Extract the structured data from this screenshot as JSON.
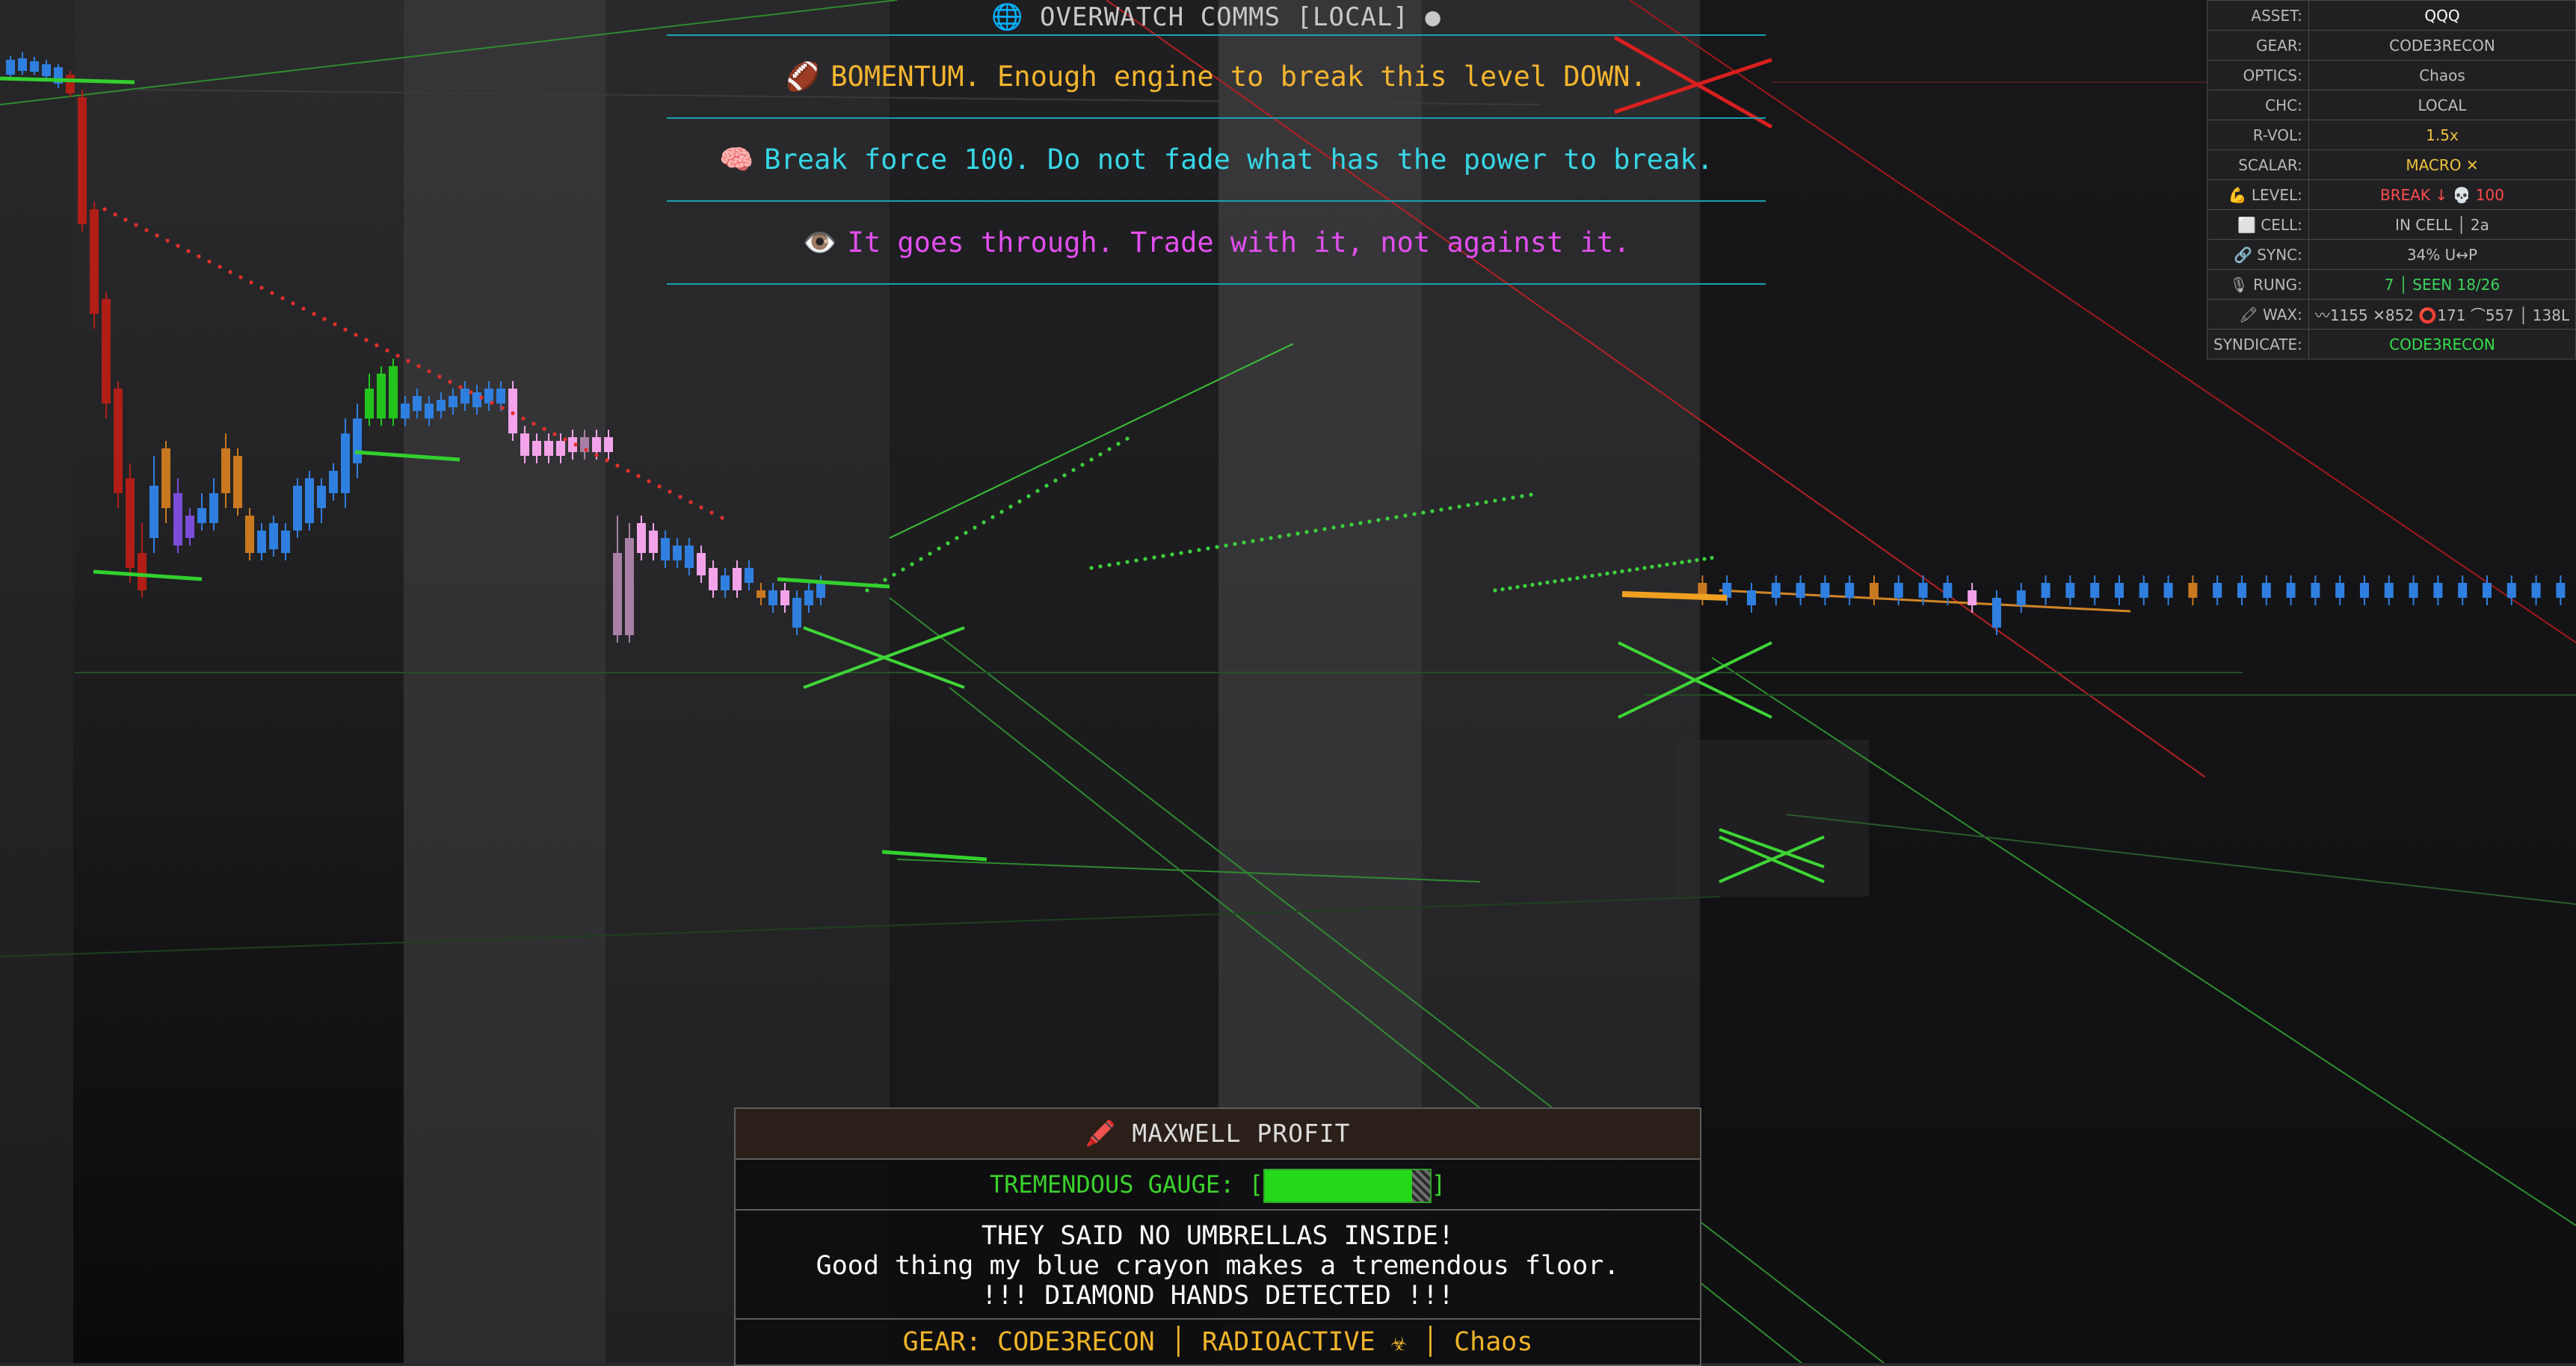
{
  "comms": {
    "title": "OVERWATCH COMMS [LOCAL]",
    "status_dot": "●",
    "globe_icon": "globe-icon",
    "messages": [
      {
        "icon": "🏈",
        "icon_name": "football-icon",
        "text": "BOMENTUM. Enough engine to break this level DOWN.",
        "color": "#f5b52e"
      },
      {
        "icon": "🧠",
        "icon_name": "brain-icon",
        "text": "Break force 100. Do not fade what has the power to break.",
        "color": "#37d6e6"
      },
      {
        "icon": "👁️",
        "icon_name": "eye-icon",
        "text": "It goes through. Trade with it, not against it.",
        "color": "#e34ff0"
      }
    ]
  },
  "stats": [
    {
      "key": "ASSET:",
      "value": "QQQ",
      "color": "#ffffff"
    },
    {
      "key": "GEAR:",
      "value": "CODE3RECON",
      "color": "#bdbdbd"
    },
    {
      "key": "OPTICS:",
      "value": "Chaos",
      "color": "#bdbdbd"
    },
    {
      "key": "CHC:",
      "value": "LOCAL",
      "color": "#bdbdbd"
    },
    {
      "key": "R-VOL:",
      "value": "1.5x",
      "color": "#f0c23a"
    },
    {
      "key": "SCALAR:",
      "value": "MACRO ✕",
      "color": "#f0c23a"
    },
    {
      "key": "💪 LEVEL:",
      "value": "BREAK ↓ 💀 100",
      "color": "#ff4b4b"
    },
    {
      "key": "⬜ CELL:",
      "value": "IN CELL │ 2a",
      "color": "#bdbdbd"
    },
    {
      "key": "🔗 SYNC:",
      "value": "34% U↔P",
      "color": "#bdbdbd"
    },
    {
      "key": "🎙 RUNG:",
      "value": "7 │ SEEN 18/26",
      "color": "#3cd65a"
    },
    {
      "key": "🖍 WAX:",
      "value": "〰1155 ✕852 ⭕171 ⌒557 │ 138L",
      "color": "#bdbdbd"
    },
    {
      "key": "SYNDICATE:",
      "value": "CODE3RECON",
      "color": "#33e04a"
    }
  ],
  "maxwell": {
    "icon": "🖍️",
    "icon_name": "crayon-icon",
    "title": "MAXWELL PROFIT",
    "gauge_label": "TREMENDOUS GAUGE: [",
    "gauge_close": "]",
    "gauge_level": 0.9,
    "lines": [
      "THEY SAID NO UMBRELLAS INSIDE!",
      "Good thing my blue crayon makes a tremendous floor.",
      "!!! DIAMOND HANDS DETECTED !!!"
    ],
    "footer": "GEAR: CODE3RECON │ RADIOACTIVE ☣ │ Chaos"
  },
  "chart_data": {
    "type": "candlestick",
    "colors": {
      "blue": "#2f7fe0",
      "pink": "#f3a3ea",
      "purple": "#7a4cd9",
      "orange": "#c9781f",
      "red": "#b01e16",
      "green": "#22c41d",
      "mauve": "#a87fa5",
      "teal": "#4a7a5a",
      "trail_red": "#e3302a",
      "trail_green": "#3bd23b"
    },
    "candles": [
      [
        8,
        80,
        100,
        75,
        105,
        "blue"
      ],
      [
        24,
        78,
        95,
        70,
        100,
        "blue"
      ],
      [
        40,
        82,
        96,
        76,
        100,
        "blue"
      ],
      [
        56,
        86,
        102,
        80,
        106,
        "blue"
      ],
      [
        72,
        90,
        112,
        86,
        118,
        "blue"
      ],
      [
        88,
        100,
        125,
        95,
        130,
        "red"
      ],
      [
        104,
        130,
        300,
        120,
        310,
        "red"
      ],
      [
        120,
        280,
        420,
        270,
        440,
        "red"
      ],
      [
        136,
        400,
        540,
        390,
        560,
        "red"
      ],
      [
        152,
        520,
        660,
        510,
        680,
        "red"
      ],
      [
        168,
        640,
        760,
        620,
        780,
        "red"
      ],
      [
        184,
        740,
        790,
        700,
        800,
        "red"
      ],
      [
        200,
        650,
        720,
        610,
        740,
        "blue"
      ],
      [
        216,
        600,
        680,
        590,
        700,
        "orange"
      ],
      [
        232,
        660,
        730,
        640,
        740,
        "purple"
      ],
      [
        248,
        690,
        720,
        680,
        730,
        "purple"
      ],
      [
        264,
        680,
        700,
        660,
        710,
        "blue"
      ],
      [
        280,
        660,
        700,
        640,
        710,
        "blue"
      ],
      [
        296,
        600,
        660,
        580,
        680,
        "orange"
      ],
      [
        312,
        610,
        680,
        600,
        690,
        "orange"
      ],
      [
        328,
        690,
        740,
        680,
        750,
        "orange"
      ],
      [
        344,
        710,
        740,
        700,
        750,
        "blue"
      ],
      [
        360,
        700,
        735,
        690,
        745,
        "blue"
      ],
      [
        376,
        710,
        740,
        700,
        750,
        "blue"
      ],
      [
        392,
        650,
        710,
        640,
        720,
        "blue"
      ],
      [
        408,
        640,
        700,
        630,
        710,
        "blue"
      ],
      [
        424,
        650,
        680,
        640,
        700,
        "blue"
      ],
      [
        440,
        630,
        660,
        620,
        670,
        "blue"
      ],
      [
        456,
        580,
        660,
        560,
        680,
        "blue"
      ],
      [
        472,
        560,
        620,
        540,
        640,
        "blue"
      ],
      [
        488,
        520,
        560,
        500,
        570,
        "green"
      ],
      [
        504,
        500,
        560,
        490,
        570,
        "green"
      ],
      [
        520,
        490,
        560,
        480,
        570,
        "green"
      ],
      [
        536,
        540,
        560,
        530,
        570,
        "blue"
      ],
      [
        552,
        530,
        550,
        520,
        560,
        "blue"
      ],
      [
        568,
        540,
        560,
        530,
        570,
        "blue"
      ],
      [
        584,
        535,
        550,
        525,
        560,
        "blue"
      ],
      [
        600,
        530,
        545,
        520,
        555,
        "blue"
      ],
      [
        616,
        520,
        540,
        510,
        550,
        "blue"
      ],
      [
        632,
        525,
        545,
        515,
        555,
        "blue"
      ],
      [
        648,
        520,
        540,
        510,
        550,
        "blue"
      ],
      [
        664,
        520,
        540,
        510,
        550,
        "blue"
      ],
      [
        680,
        520,
        580,
        510,
        590,
        "pink"
      ],
      [
        696,
        580,
        610,
        570,
        620,
        "pink"
      ],
      [
        712,
        590,
        610,
        580,
        620,
        "pink"
      ],
      [
        728,
        590,
        610,
        580,
        620,
        "pink"
      ],
      [
        744,
        590,
        610,
        580,
        620,
        "pink"
      ],
      [
        760,
        585,
        605,
        575,
        615,
        "pink"
      ],
      [
        776,
        585,
        605,
        575,
        615,
        "mauve"
      ],
      [
        792,
        585,
        605,
        575,
        615,
        "pink"
      ],
      [
        808,
        585,
        605,
        575,
        615,
        "pink"
      ],
      [
        820,
        740,
        850,
        690,
        860,
        "mauve"
      ],
      [
        836,
        720,
        850,
        700,
        860,
        "mauve"
      ],
      [
        852,
        700,
        740,
        690,
        750,
        "pink"
      ],
      [
        868,
        710,
        740,
        700,
        750,
        "pink"
      ],
      [
        884,
        720,
        750,
        710,
        760,
        "blue"
      ],
      [
        900,
        730,
        750,
        720,
        760,
        "blue"
      ],
      [
        916,
        730,
        760,
        720,
        770,
        "blue"
      ],
      [
        932,
        740,
        770,
        730,
        780,
        "pink"
      ],
      [
        948,
        760,
        790,
        750,
        800,
        "pink"
      ],
      [
        964,
        770,
        790,
        760,
        800,
        "blue"
      ],
      [
        980,
        760,
        790,
        750,
        800,
        "pink"
      ],
      [
        996,
        760,
        780,
        750,
        790,
        "blue"
      ],
      [
        1012,
        790,
        800,
        780,
        810,
        "orange"
      ],
      [
        1028,
        790,
        810,
        780,
        820,
        "blue"
      ],
      [
        1044,
        790,
        810,
        780,
        820,
        "pink"
      ],
      [
        1060,
        800,
        840,
        790,
        850,
        "blue"
      ],
      [
        1076,
        790,
        810,
        780,
        820,
        "blue"
      ],
      [
        1092,
        780,
        800,
        770,
        810,
        "blue"
      ],
      [
        1108,
        780,
        800,
        770,
        810,
        "orange"
      ],
      [
        1124,
        780,
        800,
        770,
        810,
        "blue"
      ],
      [
        1140,
        790,
        810,
        780,
        820,
        "blue"
      ],
      [
        1156,
        780,
        800,
        770,
        810,
        "blue"
      ],
      [
        1172,
        780,
        800,
        770,
        810,
        "blue"
      ],
      [
        1188,
        780,
        800,
        770,
        810,
        "blue"
      ],
      [
        1204,
        780,
        800,
        770,
        810,
        "blue"
      ],
      [
        1220,
        780,
        800,
        770,
        810,
        "orange"
      ],
      [
        1236,
        780,
        800,
        770,
        810,
        "blue"
      ],
      [
        1252,
        780,
        800,
        770,
        810,
        "blue"
      ],
      [
        1268,
        780,
        800,
        770,
        810,
        "blue"
      ],
      [
        1284,
        790,
        810,
        780,
        820,
        "pink"
      ],
      [
        1300,
        800,
        840,
        790,
        850,
        "blue"
      ],
      [
        1316,
        790,
        810,
        780,
        820,
        "blue"
      ],
      [
        1332,
        780,
        800,
        770,
        810,
        "blue"
      ],
      [
        1348,
        780,
        800,
        770,
        810,
        "blue"
      ],
      [
        1364,
        780,
        800,
        770,
        810,
        "blue"
      ],
      [
        1380,
        780,
        800,
        770,
        810,
        "blue"
      ],
      [
        1396,
        780,
        800,
        770,
        810,
        "blue"
      ],
      [
        1412,
        780,
        800,
        770,
        810,
        "blue"
      ],
      [
        1428,
        780,
        800,
        770,
        810,
        "orange"
      ],
      [
        1444,
        780,
        800,
        770,
        810,
        "blue"
      ],
      [
        1460,
        780,
        800,
        770,
        810,
        "blue"
      ],
      [
        1476,
        780,
        800,
        770,
        810,
        "blue"
      ],
      [
        1492,
        780,
        800,
        770,
        810,
        "blue"
      ],
      [
        1508,
        780,
        800,
        770,
        810,
        "blue"
      ],
      [
        1524,
        780,
        800,
        770,
        810,
        "blue"
      ],
      [
        1540,
        780,
        800,
        770,
        810,
        "blue"
      ],
      [
        1556,
        780,
        800,
        770,
        810,
        "blue"
      ],
      [
        1572,
        780,
        800,
        770,
        810,
        "blue"
      ],
      [
        1588,
        780,
        800,
        770,
        810,
        "blue"
      ],
      [
        1604,
        780,
        800,
        770,
        810,
        "blue"
      ],
      [
        1620,
        780,
        800,
        770,
        810,
        "blue"
      ],
      [
        1636,
        780,
        800,
        770,
        810,
        "blue"
      ],
      [
        1652,
        780,
        800,
        770,
        810,
        "blue"
      ],
      [
        1668,
        780,
        800,
        770,
        810,
        "blue"
      ],
      [
        1684,
        780,
        800,
        770,
        810,
        "blue"
      ],
      [
        1700,
        780,
        800,
        770,
        810,
        "blue"
      ]
    ]
  }
}
